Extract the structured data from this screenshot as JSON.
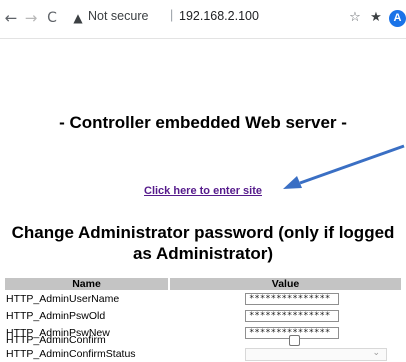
{
  "browser": {
    "back_icon": "←",
    "forward_icon": "→",
    "reload_icon": "C",
    "warning_icon": "▲",
    "security_label": "Not secure",
    "separator": "|",
    "url": "192.168.2.100",
    "bookmark_icon": "☆",
    "extensions_icon": "★",
    "avatar_letter": "A",
    "menu_icon": "⋮"
  },
  "page": {
    "server_title": "- Controller embedded Web server -",
    "enter_link": "Click here to enter site",
    "arrow_color": "#3a6fc4",
    "heading_line1": "Change Administrator password (only if logged",
    "heading_line2": "as Administrator)"
  },
  "table": {
    "columns": [
      "Name",
      "Value"
    ],
    "rows": [
      {
        "label": "HTTP_AdminUserName",
        "value": "***************"
      },
      {
        "label": "HTTP_AdminPswOld",
        "value": "***************"
      },
      {
        "label": "HTTP_AdminPswNew",
        "value": "***************"
      },
      {
        "label": "HTTP_AdminConfirm",
        "checked": false
      },
      {
        "label": "HTTP_AdminConfirmStatus",
        "selected": ""
      }
    ]
  }
}
